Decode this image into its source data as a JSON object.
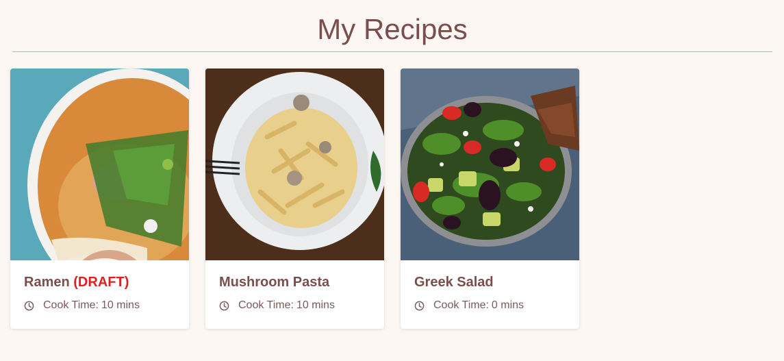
{
  "header": {
    "title": "My Recipes"
  },
  "recipes": [
    {
      "name": "Ramen",
      "draft_label": "(DRAFT)",
      "cook_time_label": "Cook Time:",
      "cook_time_value": "10 mins",
      "image_icon": "ramen-photo"
    },
    {
      "name": "Mushroom Pasta",
      "draft_label": "",
      "cook_time_label": "Cook Time:",
      "cook_time_value": "10 mins",
      "image_icon": "pasta-photo"
    },
    {
      "name": "Greek Salad",
      "draft_label": "",
      "cook_time_label": "Cook Time:",
      "cook_time_value": "0 mins",
      "image_icon": "salad-photo"
    }
  ],
  "colors": {
    "background": "#fcf7f3",
    "title": "#7b4e4e",
    "divider": "#cfb36a",
    "draft": "#e02020"
  }
}
